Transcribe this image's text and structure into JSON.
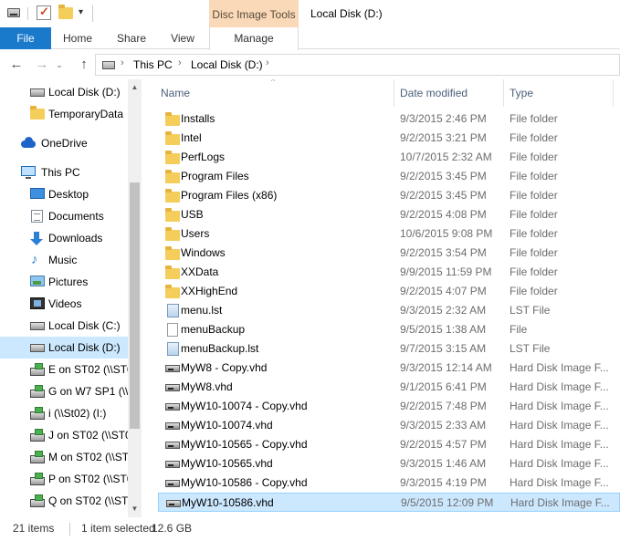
{
  "titlebar": {
    "window_title": "Local Disk (D:)",
    "context_tab_group": "Disc Image Tools",
    "qat_icons": [
      "drive-icon",
      "properties-check-icon",
      "new-folder-icon",
      "qat-dropdown-icon"
    ]
  },
  "ribbon": {
    "tabs": [
      {
        "label": "File"
      },
      {
        "label": "Home"
      },
      {
        "label": "Share"
      },
      {
        "label": "View"
      },
      {
        "label": "Manage"
      }
    ]
  },
  "address": {
    "crumbs": [
      {
        "label": "This PC"
      },
      {
        "label": "Local Disk (D:)"
      }
    ]
  },
  "navpane": {
    "items": [
      {
        "label": "Local Disk (D:)",
        "icon": "drive-icon"
      },
      {
        "label": "TemporaryData",
        "icon": "folder-icon"
      },
      {
        "label": "OneDrive",
        "icon": "onedrive-icon"
      },
      {
        "label": "This PC",
        "icon": "this-pc-icon"
      },
      {
        "label": "Desktop",
        "icon": "desktop-icon"
      },
      {
        "label": "Documents",
        "icon": "documents-icon"
      },
      {
        "label": "Downloads",
        "icon": "downloads-icon"
      },
      {
        "label": "Music",
        "icon": "music-icon"
      },
      {
        "label": "Pictures",
        "icon": "pictures-icon"
      },
      {
        "label": "Videos",
        "icon": "videos-icon"
      },
      {
        "label": "Local Disk (C:)",
        "icon": "drive-icon"
      },
      {
        "label": "Local Disk (D:)",
        "icon": "drive-icon",
        "selected": true
      },
      {
        "label": "E on ST02 (\\\\ST0",
        "icon": "network-drive-icon"
      },
      {
        "label": "G on W7 SP1 (\\\\S",
        "icon": "network-drive-icon"
      },
      {
        "label": "i (\\\\St02) (I:)",
        "icon": "network-drive-icon"
      },
      {
        "label": "J on ST02 (\\\\ST0",
        "icon": "network-drive-icon"
      },
      {
        "label": "M on ST02 (\\\\ST",
        "icon": "network-drive-icon"
      },
      {
        "label": "P on ST02 (\\\\ST0",
        "icon": "network-drive-icon"
      },
      {
        "label": "Q on ST02 (\\\\ST0",
        "icon": "network-drive-icon"
      }
    ]
  },
  "filelist": {
    "columns": {
      "name": "Name",
      "date": "Date modified",
      "type": "Type"
    },
    "rows": [
      {
        "name": "Installs",
        "date": "9/3/2015 2:46 PM",
        "type": "File folder",
        "icon": "folder-icon"
      },
      {
        "name": "Intel",
        "date": "9/2/2015 3:21 PM",
        "type": "File folder",
        "icon": "folder-icon"
      },
      {
        "name": "PerfLogs",
        "date": "10/7/2015 2:32 AM",
        "type": "File folder",
        "icon": "folder-icon"
      },
      {
        "name": "Program Files",
        "date": "9/2/2015 3:45 PM",
        "type": "File folder",
        "icon": "folder-icon"
      },
      {
        "name": "Program Files (x86)",
        "date": "9/2/2015 3:45 PM",
        "type": "File folder",
        "icon": "folder-icon"
      },
      {
        "name": "USB",
        "date": "9/2/2015 4:08 PM",
        "type": "File folder",
        "icon": "folder-icon"
      },
      {
        "name": "Users",
        "date": "10/6/2015 9:08 PM",
        "type": "File folder",
        "icon": "folder-icon"
      },
      {
        "name": "Windows",
        "date": "9/2/2015 3:54 PM",
        "type": "File folder",
        "icon": "folder-icon"
      },
      {
        "name": "XXData",
        "date": "9/9/2015 11:59 PM",
        "type": "File folder",
        "icon": "folder-icon"
      },
      {
        "name": "XXHighEnd",
        "date": "9/2/2015 4:07 PM",
        "type": "File folder",
        "icon": "folder-icon"
      },
      {
        "name": "menu.lst",
        "date": "9/3/2015 2:32 AM",
        "type": "LST File",
        "icon": "lst-file-icon"
      },
      {
        "name": "menuBackup",
        "date": "9/5/2015 1:38 AM",
        "type": "File",
        "icon": "file-icon"
      },
      {
        "name": "menuBackup.lst",
        "date": "9/7/2015 3:15 AM",
        "type": "LST File",
        "icon": "lst-file-icon"
      },
      {
        "name": "MyW8 - Copy.vhd",
        "date": "9/3/2015 12:14 AM",
        "type": "Hard Disk Image F...",
        "icon": "vhd-icon"
      },
      {
        "name": "MyW8.vhd",
        "date": "9/1/2015 6:41 PM",
        "type": "Hard Disk Image F...",
        "icon": "vhd-icon"
      },
      {
        "name": "MyW10-10074 - Copy.vhd",
        "date": "9/2/2015 7:48 PM",
        "type": "Hard Disk Image F...",
        "icon": "vhd-icon"
      },
      {
        "name": "MyW10-10074.vhd",
        "date": "9/3/2015 2:33 AM",
        "type": "Hard Disk Image F...",
        "icon": "vhd-icon"
      },
      {
        "name": "MyW10-10565 - Copy.vhd",
        "date": "9/2/2015 4:57 PM",
        "type": "Hard Disk Image F...",
        "icon": "vhd-icon"
      },
      {
        "name": "MyW10-10565.vhd",
        "date": "9/3/2015 1:46 AM",
        "type": "Hard Disk Image F...",
        "icon": "vhd-icon"
      },
      {
        "name": "MyW10-10586 - Copy.vhd",
        "date": "9/3/2015 4:19 PM",
        "type": "Hard Disk Image F...",
        "icon": "vhd-icon"
      },
      {
        "name": "MyW10-10586.vhd",
        "date": "9/5/2015 12:09 PM",
        "type": "Hard Disk Image F...",
        "icon": "vhd-icon",
        "selected": true
      }
    ]
  },
  "status": {
    "item_count": "21 items",
    "selection": "1 item selected",
    "size": "12.6 GB"
  },
  "colors": {
    "file_tab": "#1979ca",
    "context_tab": "#f9d9b8",
    "selection": "#cce8ff",
    "selection_border": "#99d1ff",
    "header_text": "#4c607a"
  }
}
